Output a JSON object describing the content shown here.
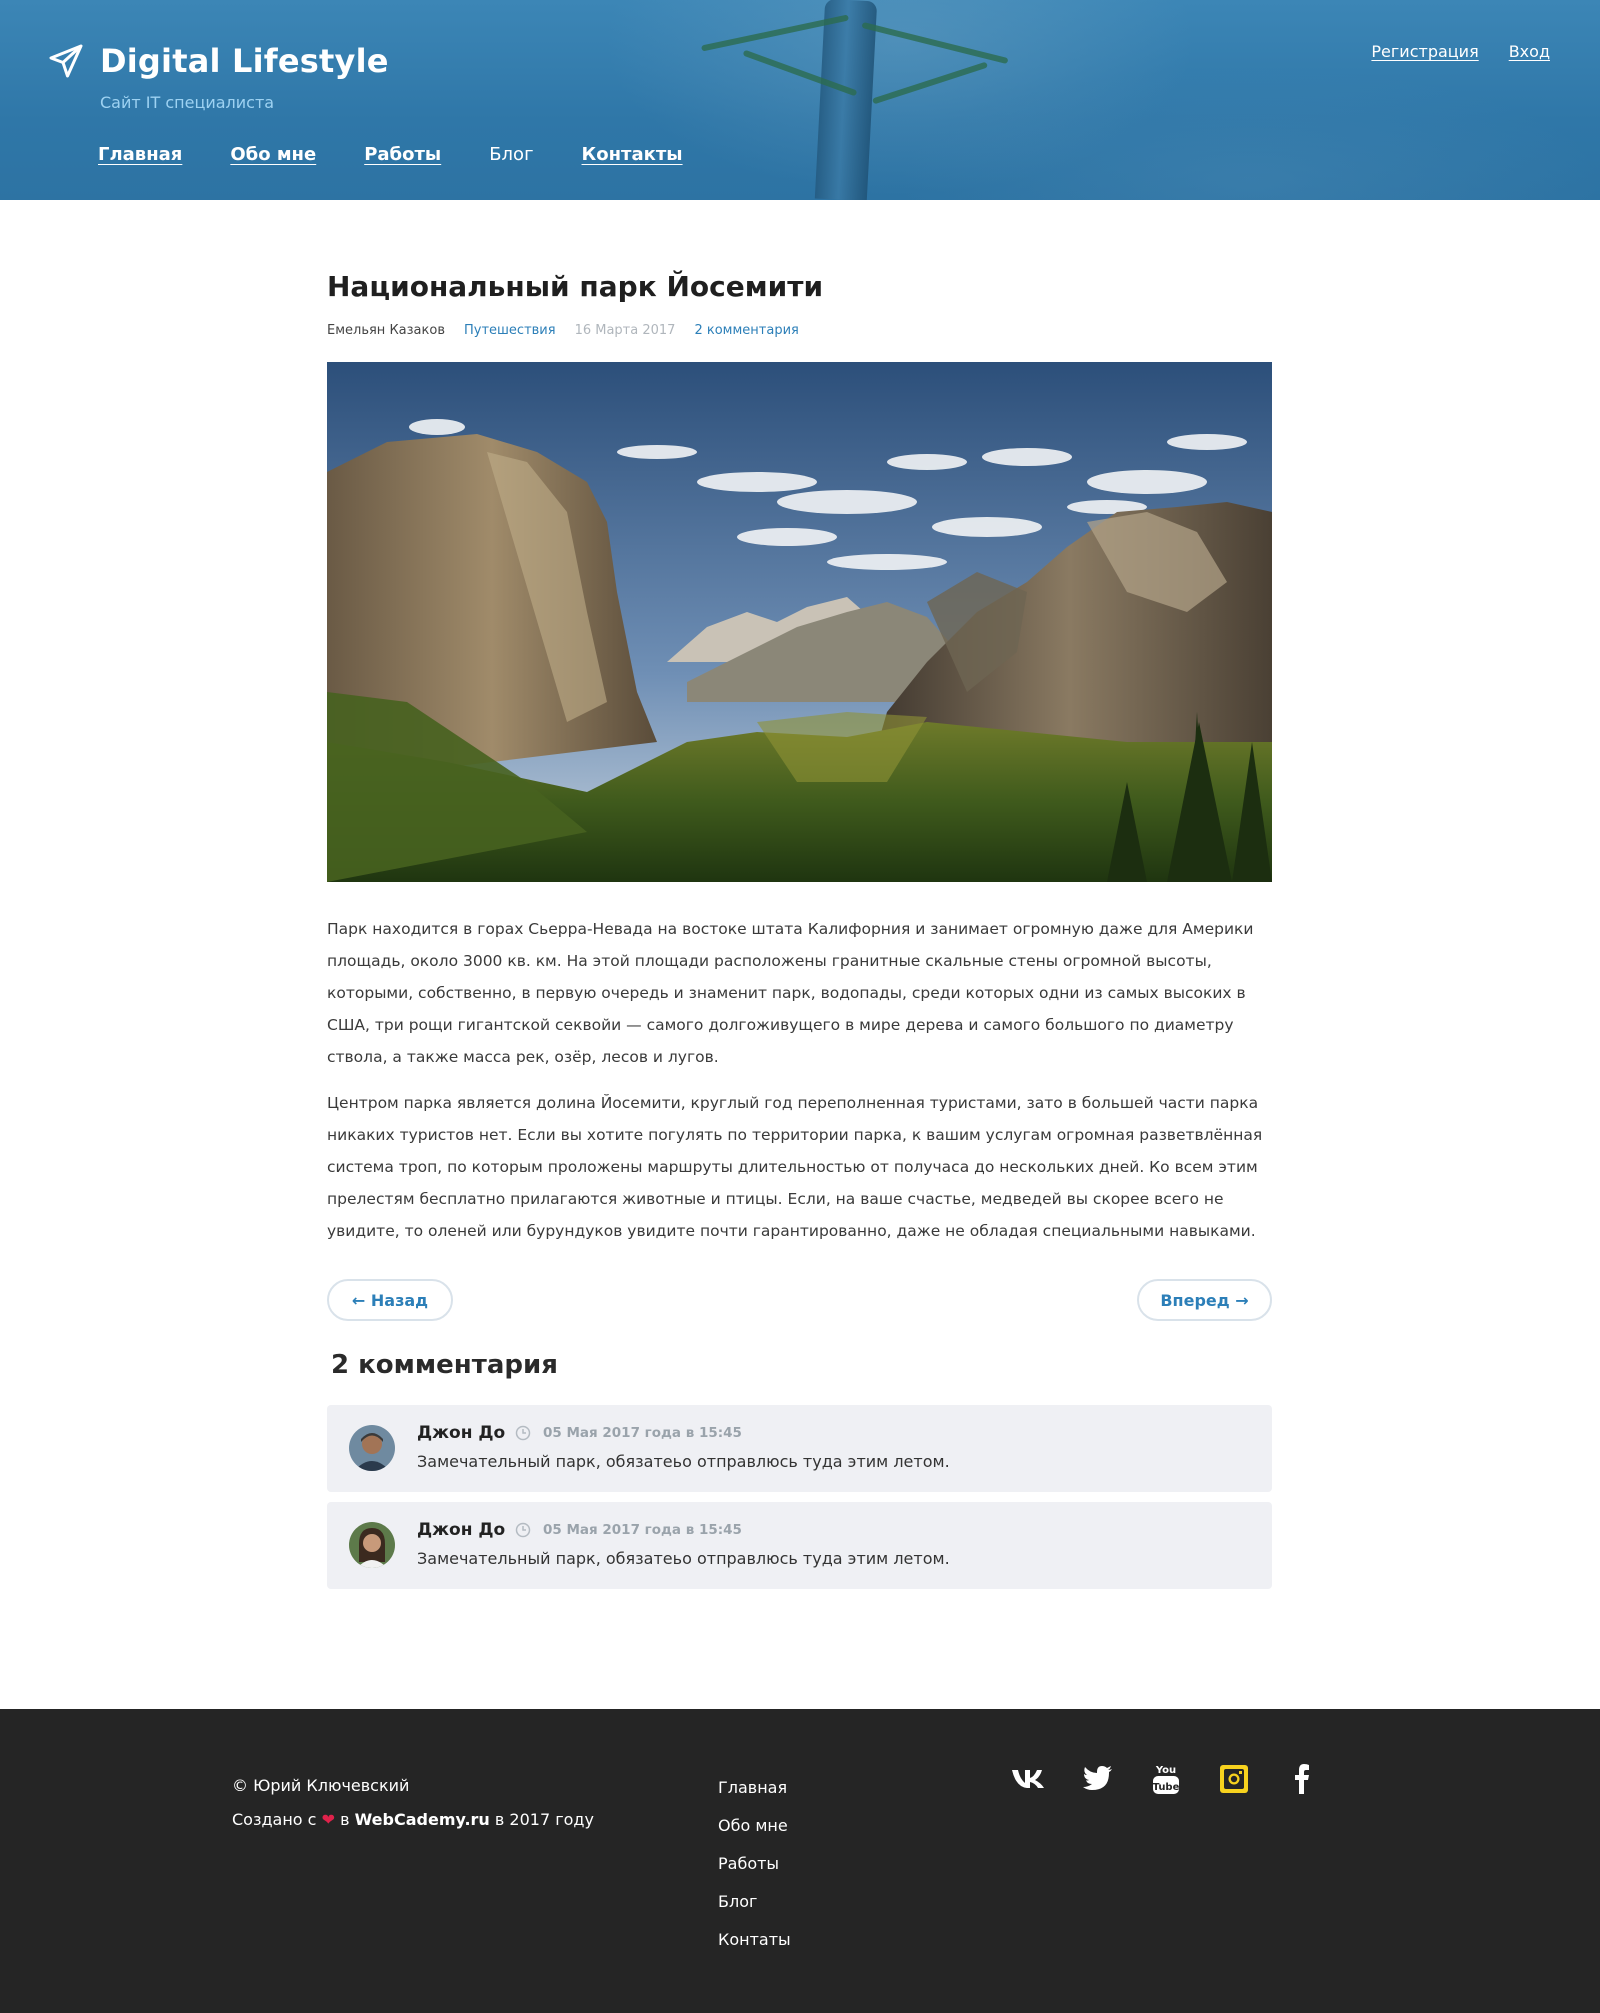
{
  "header": {
    "logo_title": "Digital Lifestyle",
    "tagline": "Сайт IT специалиста",
    "nav": [
      {
        "label": "Главная"
      },
      {
        "label": "Обо мне"
      },
      {
        "label": "Работы"
      },
      {
        "label": "Блог"
      },
      {
        "label": "Контакты"
      }
    ],
    "auth": {
      "register": "Регистрация",
      "login": "Вход"
    }
  },
  "post": {
    "title": "Национальный парк Йосемити",
    "author": "Емельян Казаков",
    "category": "Путешествия",
    "date": "16 Марта 2017",
    "comments_link": "2 комментария",
    "paragraphs": [
      "Парк находится в горах Сьерра-Невада на востоке штата Калифорния и занимает огромную даже для Америки площадь, около 3000 кв. км. На этой площади расположены гранитные скальные стены огромной высоты, которыми, собственно, в первую очередь и знаменит парк, водопады, среди которых одни из самых высоких в США, три рощи гигантской секвойи — самого долгоживущего в мире дерева и самого большого по диаметру ствола, а также масса рек, озёр, лесов и лугов.",
      "Центром парка является долина Йосемити, круглый год переполненная туристами, зато в большей части парка никаких туристов нет. Если вы хотите погулять по территории парка, к вашим услугам огромная разветвлённая система троп, по которым проложены маршруты длительностью от получаса до нескольких дней. Ко всем этим прелестям бесплатно прилагаются животные и птицы. Если, на ваше счастье, медведей вы скорее всего не увидите, то оленей или бурундуков увидите почти гарантированно, даже не обладая специальными навыками."
    ]
  },
  "pager": {
    "prev": "← Назад",
    "next": "Вперед →"
  },
  "comments": {
    "title": "2 комментария",
    "items": [
      {
        "name": "Джон До",
        "time": "05 Мая 2017 года в 15:45",
        "text": "Замечательный парк, обязатеьо отправлюсь туда этим летом."
      },
      {
        "name": "Джон До",
        "time": "05 Мая 2017 года в 15:45",
        "text": "Замечательный парк, обязатеьо отправлюсь туда этим летом."
      }
    ]
  },
  "footer": {
    "copyright": "© Юрий Ключевский",
    "made_prefix": "Создано с",
    "made_in": "в",
    "made_site": "WebCademy.ru",
    "made_suffix": "в 2017 году",
    "nav": [
      "Главная",
      "Обо мне",
      "Работы",
      "Блог",
      "Контаты"
    ],
    "social": [
      "vk-icon",
      "twitter-icon",
      "youtube-icon",
      "instagram-icon",
      "facebook-icon"
    ]
  },
  "colors": {
    "header_blue": "#2f77a8",
    "link_blue": "#2c7fb8",
    "footer_bg": "#252525",
    "comment_bg": "#eff0f4"
  }
}
